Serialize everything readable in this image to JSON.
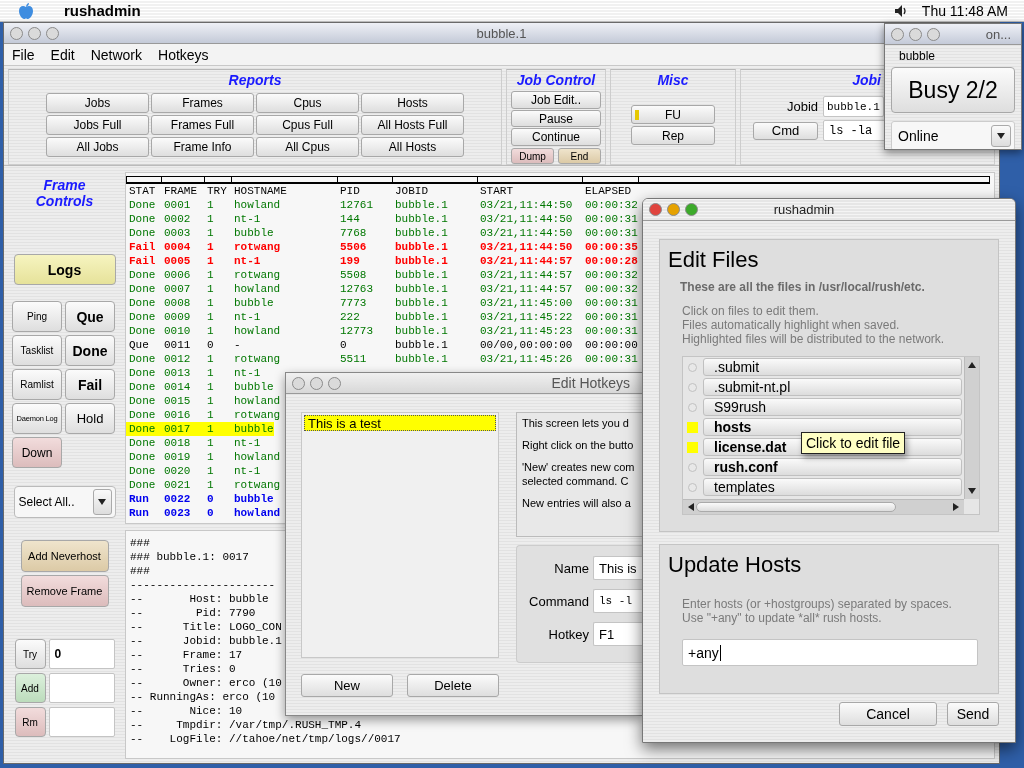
{
  "menubar": {
    "app_name": "rushadmin",
    "clock": "Thu 11:48 AM"
  },
  "main_window": {
    "title": "bubble.1",
    "menu": [
      "File",
      "Edit",
      "Network",
      "Hotkeys"
    ],
    "reports": {
      "title": "Reports",
      "buttons": [
        "Jobs",
        "Frames",
        "Cpus",
        "Hosts",
        "Jobs Full",
        "Frames Full",
        "Cpus Full",
        "All Hosts Full",
        "All Jobs",
        "Frame Info",
        "All Cpus",
        "All Hosts"
      ]
    },
    "job_control": {
      "title": "Job Control",
      "buttons": [
        "Job Edit..",
        "Pause",
        "Continue"
      ],
      "stop_buttons": [
        {
          "label": "Dump",
          "kind": "danger"
        },
        {
          "label": "End",
          "kind": "caution"
        }
      ]
    },
    "misc": {
      "title": "Misc",
      "buttons": [
        {
          "label": "FU",
          "kind": "marked"
        },
        {
          "label": "Rep",
          "kind": "plain"
        }
      ]
    },
    "jobid_panel": {
      "title": "Jobi",
      "jobid_label": "Jobid",
      "jobid_value": "bubble.1",
      "cmd_button": "Cmd",
      "cmd_value": "ls -la"
    },
    "frame_controls": {
      "title": "Frame Controls",
      "logs_button": "Logs",
      "buttons": [
        {
          "label": "Ping",
          "kind": "tool"
        },
        {
          "label": "Que",
          "kind": "filter"
        },
        {
          "label": "Tasklist",
          "kind": "tool"
        },
        {
          "label": "Done",
          "kind": "filter"
        },
        {
          "label": "Ramlist",
          "kind": "tool"
        },
        {
          "label": "Fail",
          "kind": "filter"
        },
        {
          "label": "Daemon Log",
          "kind": "tiny"
        },
        {
          "label": "Hold",
          "kind": "plain"
        },
        {
          "label": "Down",
          "kind": "danger"
        }
      ],
      "select": "Select All..",
      "action_buttons": [
        {
          "label": "Add Neverhost",
          "kind": "caution"
        },
        {
          "label": "Remove Frame",
          "kind": "danger"
        }
      ],
      "entries": [
        {
          "label": "Try",
          "kind": "neutral",
          "value": "0"
        },
        {
          "label": "Add",
          "kind": "ok"
        },
        {
          "label": "Rm",
          "kind": "danger"
        }
      ]
    },
    "table": {
      "columns": [
        "STAT",
        "FRAME",
        "TRY",
        "HOSTNAME",
        "PID",
        "JOBID",
        "START",
        "ELAPSED"
      ],
      "rows": [
        {
          "kind": "done",
          "selected": false,
          "cells": [
            "Done",
            "0001",
            "1",
            "howland",
            "12761",
            "bubble.1",
            "03/21,11:44:50",
            "00:00:32"
          ]
        },
        {
          "kind": "done",
          "selected": false,
          "cells": [
            "Done",
            "0002",
            "1",
            "nt-1",
            "144",
            "bubble.1",
            "03/21,11:44:50",
            "00:00:31"
          ]
        },
        {
          "kind": "done",
          "selected": false,
          "cells": [
            "Done",
            "0003",
            "1",
            "bubble",
            "7768",
            "bubble.1",
            "03/21,11:44:50",
            "00:00:31"
          ]
        },
        {
          "kind": "fail",
          "selected": false,
          "cells": [
            "Fail",
            "0004",
            "1",
            "rotwang",
            "5506",
            "bubble.1",
            "03/21,11:44:50",
            "00:00:35"
          ]
        },
        {
          "kind": "fail",
          "selected": false,
          "cells": [
            "Fail",
            "0005",
            "1",
            "nt-1",
            "199",
            "bubble.1",
            "03/21,11:44:57",
            "00:00:28"
          ]
        },
        {
          "kind": "done",
          "selected": false,
          "cells": [
            "Done",
            "0006",
            "1",
            "rotwang",
            "5508",
            "bubble.1",
            "03/21,11:44:57",
            "00:00:32"
          ]
        },
        {
          "kind": "done",
          "selected": false,
          "cells": [
            "Done",
            "0007",
            "1",
            "howland",
            "12763",
            "bubble.1",
            "03/21,11:44:57",
            "00:00:32"
          ]
        },
        {
          "kind": "done",
          "selected": false,
          "cells": [
            "Done",
            "0008",
            "1",
            "bubble",
            "7773",
            "bubble.1",
            "03/21,11:45:00",
            "00:00:31"
          ]
        },
        {
          "kind": "done",
          "selected": false,
          "cells": [
            "Done",
            "0009",
            "1",
            "nt-1",
            "222",
            "bubble.1",
            "03/21,11:45:22",
            "00:00:31"
          ]
        },
        {
          "kind": "done",
          "selected": false,
          "cells": [
            "Done",
            "0010",
            "1",
            "howland",
            "12773",
            "bubble.1",
            "03/21,11:45:23",
            "00:00:31"
          ]
        },
        {
          "kind": "queued",
          "selected": false,
          "cells": [
            "Que",
            "0011",
            "0",
            "-",
            "0",
            "bubble.1",
            "00/00,00:00:00",
            "00:00:00"
          ]
        },
        {
          "kind": "done",
          "selected": false,
          "cells": [
            "Done",
            "0012",
            "1",
            "rotwang",
            "5511",
            "bubble.1",
            "03/21,11:45:26",
            "00:00:31"
          ]
        },
        {
          "kind": "done",
          "selected": false,
          "cells": [
            "Done",
            "0013",
            "1",
            "nt-1"
          ]
        },
        {
          "kind": "done",
          "selected": false,
          "cells": [
            "Done",
            "0014",
            "1",
            "bubble"
          ]
        },
        {
          "kind": "done",
          "selected": false,
          "cells": [
            "Done",
            "0015",
            "1",
            "howland"
          ]
        },
        {
          "kind": "done",
          "selected": false,
          "cells": [
            "Done",
            "0016",
            "1",
            "rotwang"
          ]
        },
        {
          "kind": "done",
          "selected": true,
          "cells": [
            "Done",
            "0017",
            "1",
            "bubble"
          ]
        },
        {
          "kind": "done",
          "selected": false,
          "cells": [
            "Done",
            "0018",
            "1",
            "nt-1"
          ]
        },
        {
          "kind": "done",
          "selected": false,
          "cells": [
            "Done",
            "0019",
            "1",
            "howland"
          ]
        },
        {
          "kind": "done",
          "selected": false,
          "cells": [
            "Done",
            "0020",
            "1",
            "nt-1"
          ]
        },
        {
          "kind": "done",
          "selected": false,
          "cells": [
            "Done",
            "0021",
            "1",
            "rotwang"
          ]
        },
        {
          "kind": "running",
          "selected": false,
          "cells": [
            "Run",
            "0022",
            "0",
            "bubble"
          ]
        },
        {
          "kind": "running",
          "selected": false,
          "cells": [
            "Run",
            "0023",
            "0",
            "howland"
          ]
        }
      ]
    },
    "log": [
      "###",
      "### bubble.1: 0017",
      "###",
      "----------------------",
      "--       Host: bubble",
      "--        Pid: 7790",
      "--      Title: LOGO_CON",
      "--      Jobid: bubble.1",
      "--      Frame: 17",
      "--      Tries: 0",
      "--      Owner: erco (10",
      "-- RunningAs: erco (10",
      "--       Nice: 10",
      "--     Tmpdir: /var/tmp/.RUSH_TMP.4",
      "--    LogFile: //tahoe/net/tmp/logs//0017"
    ]
  },
  "online_window": {
    "title": "on...",
    "host": "bubble",
    "status": "Busy 2/2",
    "mode": "Online"
  },
  "hotkeys_window": {
    "title": "Edit Hotkeys",
    "items": [
      {
        "label": "This is a test",
        "selected": true
      }
    ],
    "help": [
      [
        "This screen lets you d"
      ],
      [
        "Right click on the butto"
      ],
      [
        "'New' creates new com",
        "selected command.  C"
      ],
      [
        "New entries will also a"
      ]
    ],
    "fields": [
      {
        "label": "Name",
        "value": "This is",
        "kind": "text"
      },
      {
        "label": "Command",
        "value": "ls -l",
        "kind": "code"
      },
      {
        "label": "Hotkey",
        "value": "F1",
        "kind": "text"
      }
    ],
    "buttons": [
      "New",
      "Delete"
    ]
  },
  "files_dialog": {
    "title": "rushadmin",
    "edit_files": {
      "heading": "Edit Files",
      "subheading": "These are all the files in /usr/local/rush/etc.",
      "instructions": [
        "Click on files to edit them.",
        "Files automatically highlight when saved.",
        "Highlighted files will be distributed to the network."
      ],
      "files": [
        {
          "name": ".submit",
          "highlighted": false,
          "bold": false
        },
        {
          "name": ".submit-nt.pl",
          "highlighted": false,
          "bold": false
        },
        {
          "name": "S99rush",
          "highlighted": false,
          "bold": false
        },
        {
          "name": "hosts",
          "highlighted": true,
          "bold": true
        },
        {
          "name": "license.dat",
          "highlighted": true,
          "bold": true
        },
        {
          "name": "rush.conf",
          "highlighted": false,
          "bold": true
        },
        {
          "name": "templates",
          "highlighted": false,
          "bold": false
        }
      ],
      "tooltip": "Click to edit file"
    },
    "update_hosts": {
      "heading": "Update Hosts",
      "instructions": [
        "Enter hosts (or +hostgroups) separated by spaces.",
        "Use \"+any\" to update *all* rush hosts."
      ],
      "value": "+any"
    },
    "buttons": [
      "Cancel",
      "Send"
    ]
  }
}
